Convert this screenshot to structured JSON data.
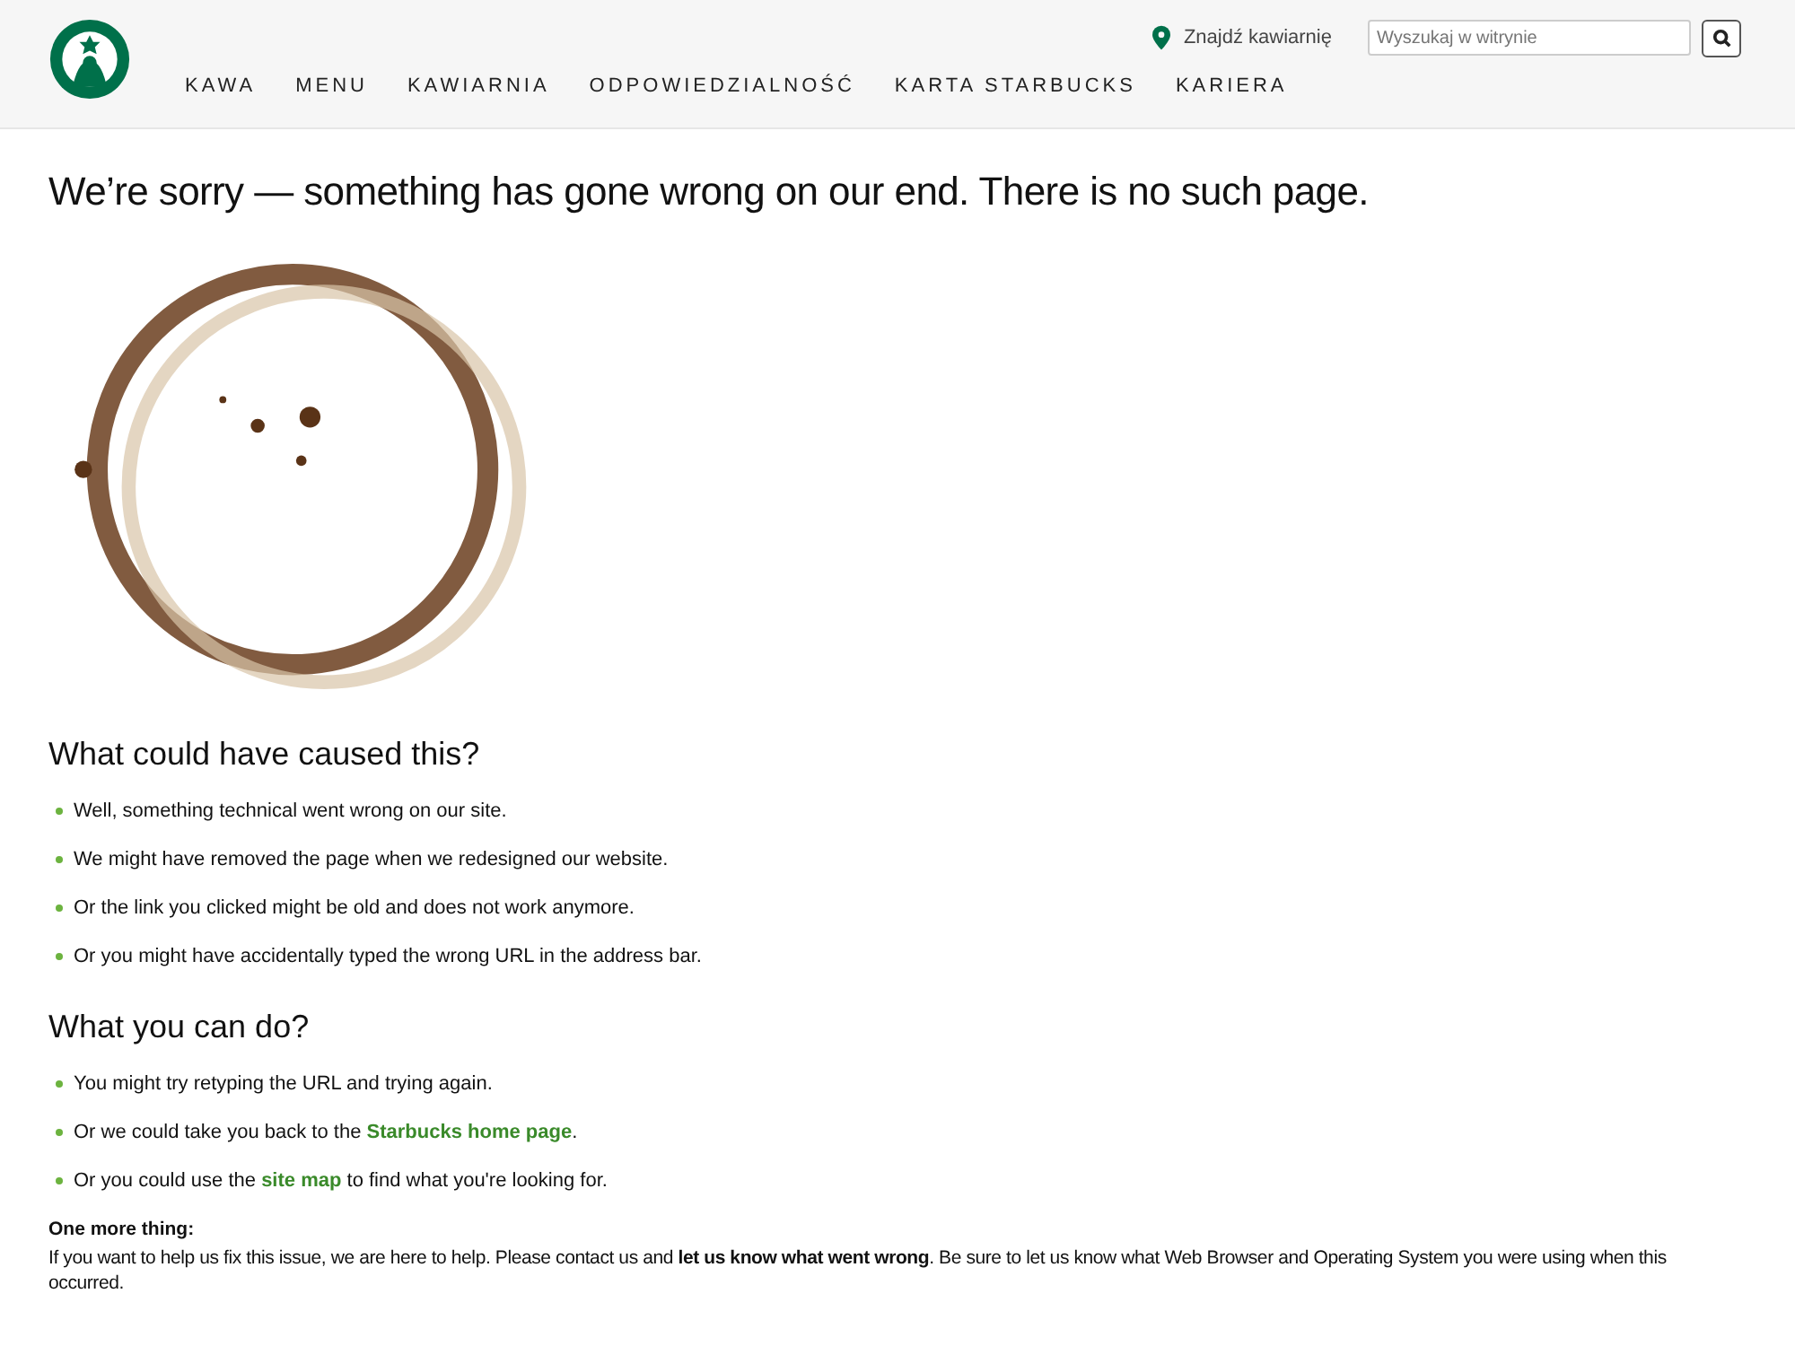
{
  "header": {
    "store_link": "Znajdź kawiarnię",
    "search": {
      "placeholder": "Wyszukaj w witrynie"
    },
    "nav": [
      {
        "label": "KAWA"
      },
      {
        "label": "MENU"
      },
      {
        "label": "KAWIARNIA"
      },
      {
        "label": "ODPOWIEDZIALNOŚĆ"
      },
      {
        "label": "KARTA STARBUCKS"
      },
      {
        "label": "KARIERA"
      }
    ]
  },
  "title": "We’re sorry — something has gone wrong on our end. There is no such page.",
  "sections": [
    {
      "heading": "What could have caused this?",
      "items": [
        {
          "segments": [
            {
              "text": "Well, something technical went wrong on our site.",
              "link": false
            }
          ]
        },
        {
          "segments": [
            {
              "text": "We might have removed the page when we redesigned our website.",
              "link": false
            }
          ]
        },
        {
          "segments": [
            {
              "text": "Or the link you clicked might be old and does not work anymore.",
              "link": false
            }
          ]
        },
        {
          "segments": [
            {
              "text": "Or you might have accidentally typed the wrong URL in the address bar.",
              "link": false
            }
          ]
        }
      ]
    },
    {
      "heading": "What you can do?",
      "items": [
        {
          "segments": [
            {
              "text": "You might try retyping the URL and trying again.",
              "link": false
            }
          ]
        },
        {
          "segments": [
            {
              "text": "Or we could take you back to the ",
              "link": false
            },
            {
              "text": "Starbucks home page",
              "link": true
            },
            {
              "text": ".",
              "link": false
            }
          ]
        },
        {
          "segments": [
            {
              "text": "Or you could use the ",
              "link": false
            },
            {
              "text": "site map",
              "link": true
            },
            {
              "text": " to find what you're looking for.",
              "link": false
            }
          ]
        }
      ]
    }
  ],
  "footer": {
    "heading": "One more thing:",
    "text": "If you want to help us fix this issue, we are here to help. Please contact us and **let us know what went wrong**. Be sure to let us know what Web Browser and Operating System you were using when this occurred."
  }
}
